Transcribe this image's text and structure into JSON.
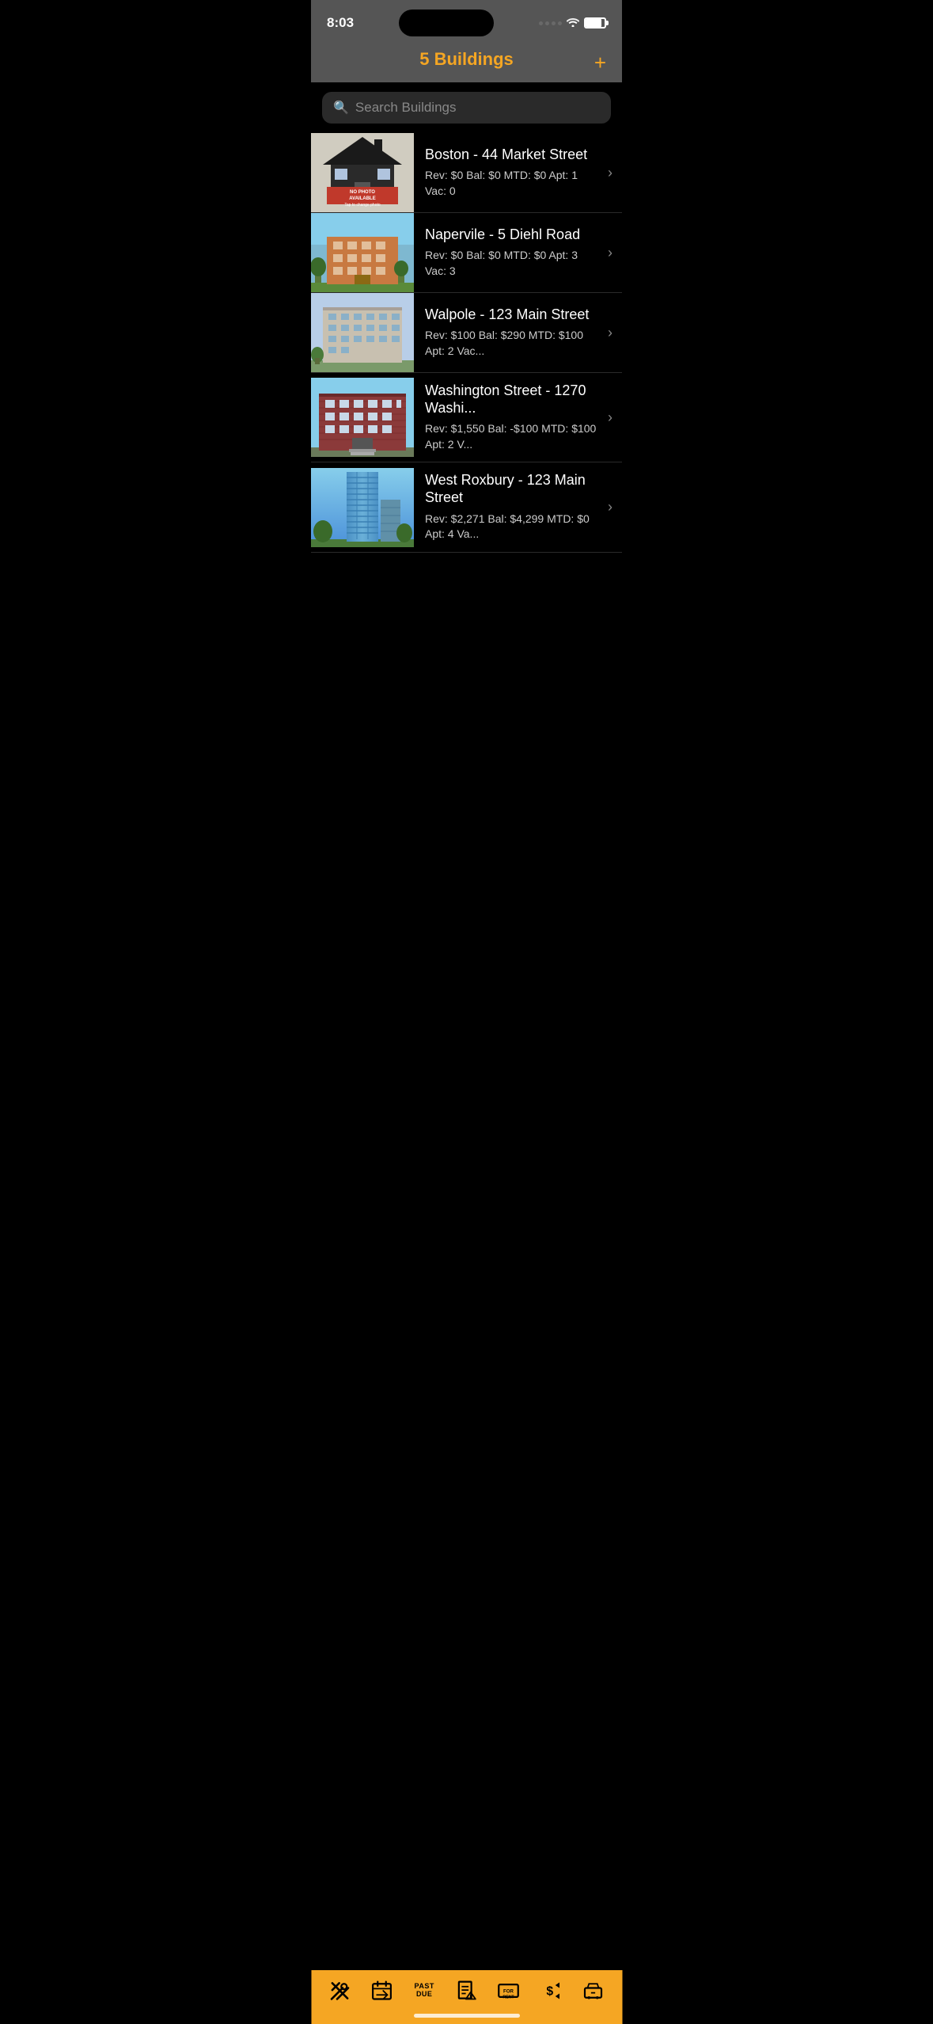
{
  "statusBar": {
    "time": "8:03"
  },
  "header": {
    "title": "5 Buildings",
    "addButtonLabel": "+"
  },
  "search": {
    "placeholder": "Search Buildings"
  },
  "buildings": [
    {
      "id": "boston",
      "name": "Boston - 44 Market Street",
      "stats": "Rev: $0 Bal: $0 MTD: $0 Apt: 1 Vac: 0",
      "imageType": "no-photo"
    },
    {
      "id": "naperville",
      "name": "Napervile - 5 Diehl Road",
      "stats": "Rev: $0 Bal: $0 MTD: $0 Apt: 3 Vac: 3",
      "imageType": "naperville"
    },
    {
      "id": "walpole",
      "name": "Walpole - 123 Main Street",
      "stats": "Rev: $100 Bal: $290 MTD: $100 Apt: 2 Vac...",
      "imageType": "walpole"
    },
    {
      "id": "washington",
      "name": "Washington Street - 1270 Washi...",
      "stats": "Rev: $1,550 Bal: -$100 MTD: $100 Apt: 2 V...",
      "imageType": "washington"
    },
    {
      "id": "westRoxbury",
      "name": "West Roxbury - 123 Main Street",
      "stats": "Rev: $2,271 Bal: $4,299 MTD: $0 Apt: 4 Va...",
      "imageType": "westRoxbury"
    }
  ],
  "tabBar": {
    "items": [
      {
        "id": "tools",
        "label": "Tools"
      },
      {
        "id": "calendar",
        "label": "Calendar"
      },
      {
        "id": "pastDue",
        "label": "Past Due"
      },
      {
        "id": "reports",
        "label": "Reports"
      },
      {
        "id": "forRent",
        "label": "For Rent"
      },
      {
        "id": "payments",
        "label": "Payments"
      },
      {
        "id": "more",
        "label": "More"
      }
    ]
  }
}
